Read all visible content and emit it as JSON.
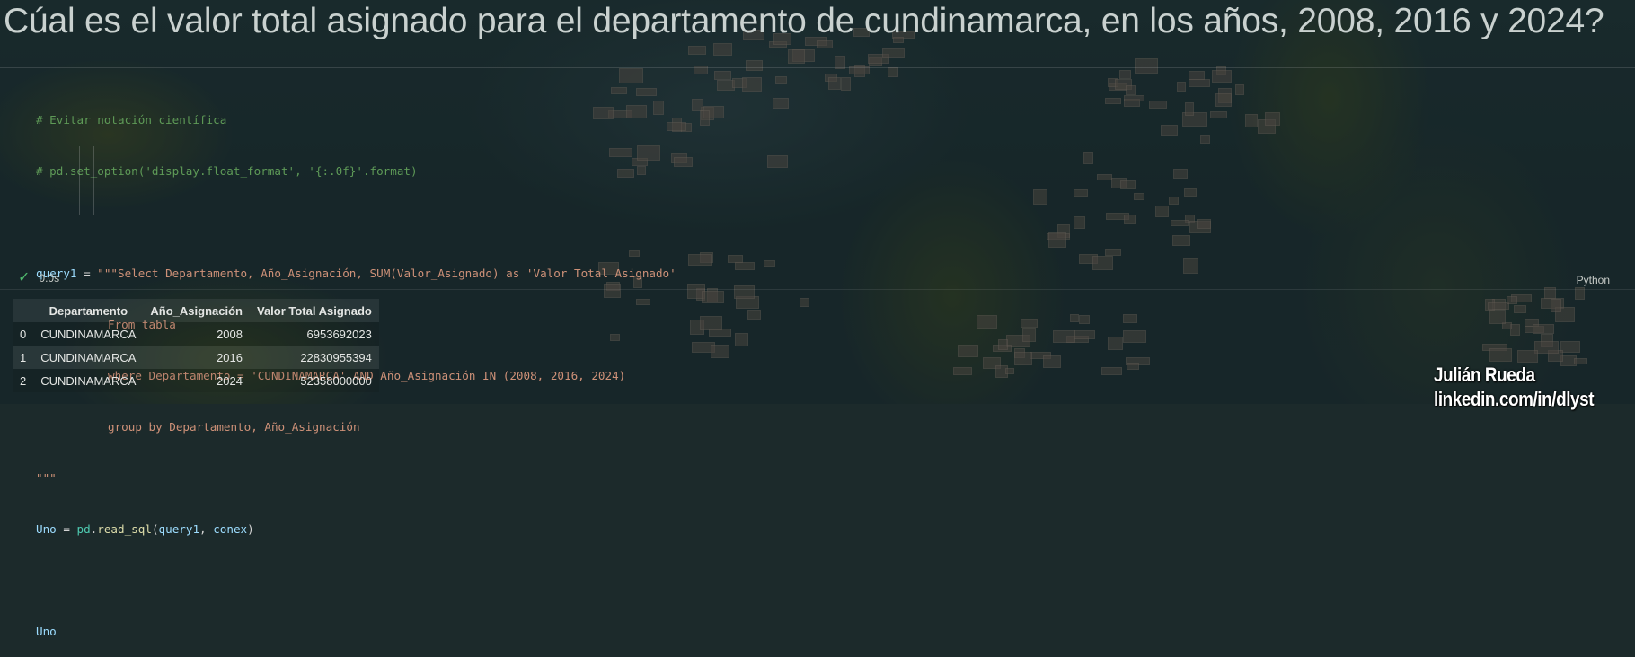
{
  "title": "Cúal es el valor total asignado para el departamento de cundinamarca, en los años, 2008, 2016 y 2024?",
  "code": {
    "comment1": "# Evitar notación científica",
    "comment2": "# pd.set_option('display.float_format', '{:.0f}'.format)",
    "query_var": "query1",
    "assign": " = ",
    "sql_line1": "\"\"\"Select Departamento, Año_Asignación, SUM(Valor_Asignado) as 'Valor Total Asignado'",
    "sql_line2": "From tabla",
    "sql_line3": "where Departamento = 'CUNDINAMARCA' AND Año_Asignación IN (2008, 2016, 2024)",
    "sql_line4": "group by Departamento, Año_Asignación",
    "sql_close": "\"\"\"",
    "uno_var": "Uno",
    "pd": "pd",
    "dot": ".",
    "read_sql": "read_sql",
    "open_paren": "(",
    "arg1": "query1",
    "comma": ", ",
    "arg2": "conex",
    "close_paren": ")",
    "uno_display": "Uno"
  },
  "status": {
    "check_icon": "check-icon",
    "exec_time": "0.0s",
    "language": "Python"
  },
  "table": {
    "columns": [
      "",
      "Departamento",
      "Año_Asignación",
      "Valor Total Asignado"
    ],
    "rows": [
      {
        "index": "0",
        "departamento": "CUNDINAMARCA",
        "anio": "2008",
        "valor": "6953692023"
      },
      {
        "index": "1",
        "departamento": "CUNDINAMARCA",
        "anio": "2016",
        "valor": "22830955394"
      },
      {
        "index": "2",
        "departamento": "CUNDINAMARCA",
        "anio": "2024",
        "valor": "52358000000"
      }
    ]
  },
  "credit": {
    "name": "Julián Rueda",
    "link": "linkedin.com/in/dlyst"
  },
  "colors": {
    "comment": "#5e9a57",
    "string": "#ce9178",
    "variable": "#9cdcfe",
    "function": "#dcdcaa",
    "module": "#4ec9b0",
    "success": "#4fb86d"
  }
}
